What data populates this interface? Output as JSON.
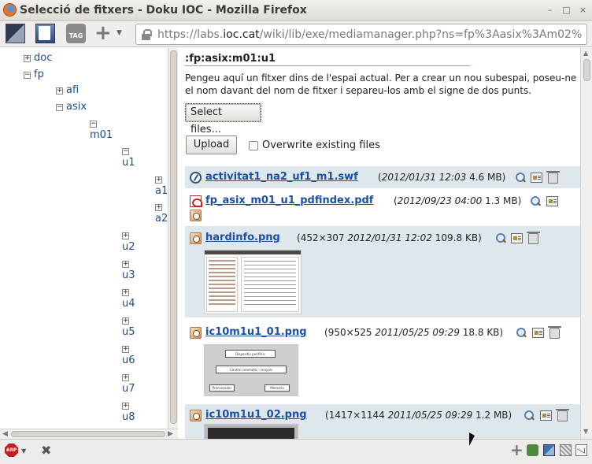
{
  "window": {
    "title": "Selecció de fitxers - Doku IOC - Mozilla Firefox",
    "url_prefix": "https://labs.",
    "url_domain": "ioc.cat",
    "url_path": "/wiki/lib/exe/mediamanager.php?ns=fp%3Aasix%3Am02%",
    "toolbar_tag_label": "TAG",
    "controls": {
      "minimize": "–",
      "maximize": "□",
      "close": "×"
    }
  },
  "tree": {
    "nodes": [
      {
        "label": "doc",
        "toggle": "+"
      },
      {
        "label": "fp",
        "toggle": "−"
      },
      {
        "label": "afi",
        "toggle": "+"
      },
      {
        "label": "asix",
        "toggle": "−"
      },
      {
        "label": "m01",
        "toggle": "−"
      },
      {
        "label": "u1",
        "toggle": "−"
      },
      {
        "label": "a1",
        "toggle": "+"
      },
      {
        "label": "a2",
        "toggle": "+"
      },
      {
        "label": "u2",
        "toggle": "+"
      },
      {
        "label": "u3",
        "toggle": "+"
      },
      {
        "label": "u4",
        "toggle": "+"
      },
      {
        "label": "u5",
        "toggle": "+"
      },
      {
        "label": "u6",
        "toggle": "+"
      },
      {
        "label": "u7",
        "toggle": "+"
      },
      {
        "label": "u8",
        "toggle": "+"
      }
    ]
  },
  "main": {
    "namespace": ":fp:asix:m01:u1",
    "intro": "Pengeu aquí un fitxer dins de l'espai actual. Per a crear un nou subespai, poseu-ne el nom davant del nom de fitxer i separeu-los amb el signe de dos punts.",
    "select_files_label": "Select files...",
    "upload_label": "Upload",
    "overwrite_label": "Overwrite existing files",
    "files": [
      {
        "name": "activitat1_na2_uf1_m1.swf",
        "dims": "",
        "date": "2012/01/31 12:03",
        "size": "4.6 MB",
        "type": "swf"
      },
      {
        "name": "fp_asix_m01_u1_pdfindex.pdf",
        "dims": "",
        "date": "2012/09/23 04:00",
        "size": "1.3 MB",
        "type": "pdf"
      },
      {
        "name": "hardinfo.png",
        "dims": "452×307",
        "date": "2012/01/31 12:02",
        "size": "109.8 KB",
        "type": "png"
      },
      {
        "name": "ic10m1u1_01.png",
        "dims": "950×525",
        "date": "2011/05/25 09:29",
        "size": "18.8 KB",
        "type": "png"
      },
      {
        "name": "ic10m1u1_02.png",
        "dims": "1417×1144",
        "date": "2011/05/25 09:29",
        "size": "1.2 MB",
        "type": "png"
      }
    ],
    "diagram_labels": {
      "top": "Dispositiu perifèric",
      "middle": "Control cinemàtic i senyals",
      "left": "Processador",
      "right": "Memòria"
    }
  },
  "statusbar": {
    "adblock_label": "ABP"
  }
}
